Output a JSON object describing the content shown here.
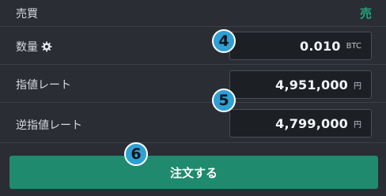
{
  "trade": {
    "label": "売買",
    "side": "売"
  },
  "quantity": {
    "label": "数量",
    "icon": "gear-icon",
    "value": "0.010",
    "unit": "BTC"
  },
  "limit_rate": {
    "label": "指値レート",
    "value": "4,951,000",
    "unit": "円"
  },
  "stop_rate": {
    "label": "逆指値レート",
    "value": "4,799,000",
    "unit": "円"
  },
  "steps": {
    "quantity": "4",
    "rates": "5",
    "order": "6"
  },
  "order_button": {
    "label": "注文する"
  },
  "colors": {
    "background": "#2a2d33",
    "sell_accent": "#20a37a",
    "order_button": "#1f8a6e",
    "step_badge": "#2f9fd4"
  }
}
